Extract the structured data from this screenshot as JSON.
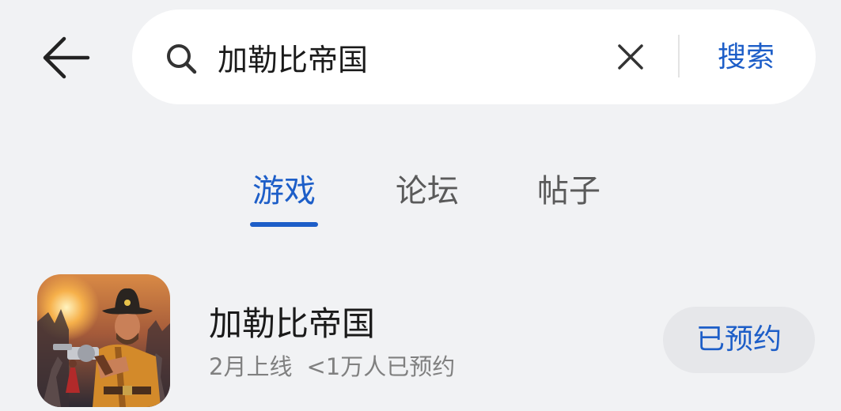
{
  "search": {
    "query": "加勒比帝国",
    "submit_label": "搜索"
  },
  "tabs": [
    {
      "label": "游戏",
      "active": true
    },
    {
      "label": "论坛",
      "active": false
    },
    {
      "label": "帖子",
      "active": false
    }
  ],
  "result": {
    "title": "加勒比帝国",
    "release": "2月上线",
    "reservations": "<1万人已预约",
    "button_label": "已预约",
    "icon": "game-cover-cowboy-icon"
  },
  "colors": {
    "accent": "#1d5ec8",
    "background": "#f1f2f4"
  }
}
